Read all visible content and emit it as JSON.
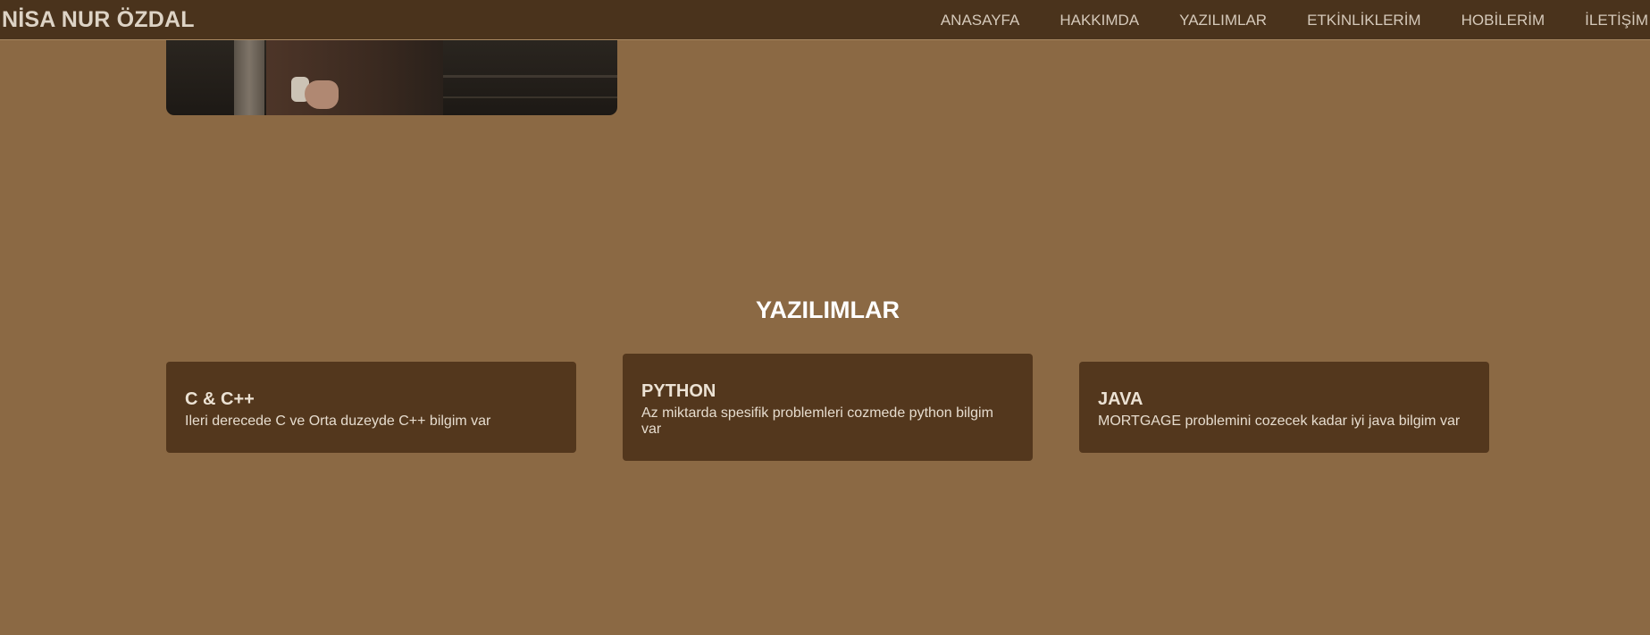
{
  "header": {
    "brand": "NİSA NUR ÖZDAL",
    "nav": [
      "ANASAYFA",
      "HAKKIMDA",
      "YAZILIMLAR",
      "ETKİNLİKLERİM",
      "HOBİLERİM",
      "İLETİŞİM"
    ]
  },
  "section": {
    "title": "YAZILIMLAR",
    "cards": [
      {
        "title": "C & C++",
        "text": "Ileri derecede C ve Orta duzeyde C++ bilgim var"
      },
      {
        "title": "PYTHON",
        "text": "Az miktarda spesifik problemleri cozmede python bilgim var"
      },
      {
        "title": "JAVA",
        "text": "MORTGAGE problemini cozecek kadar iyi java bilgim var"
      }
    ]
  },
  "colors": {
    "page_background": "#8b6944",
    "navbar_background": "#4a331c",
    "card_background": "#53371d",
    "heading_text": "#ffffff"
  }
}
